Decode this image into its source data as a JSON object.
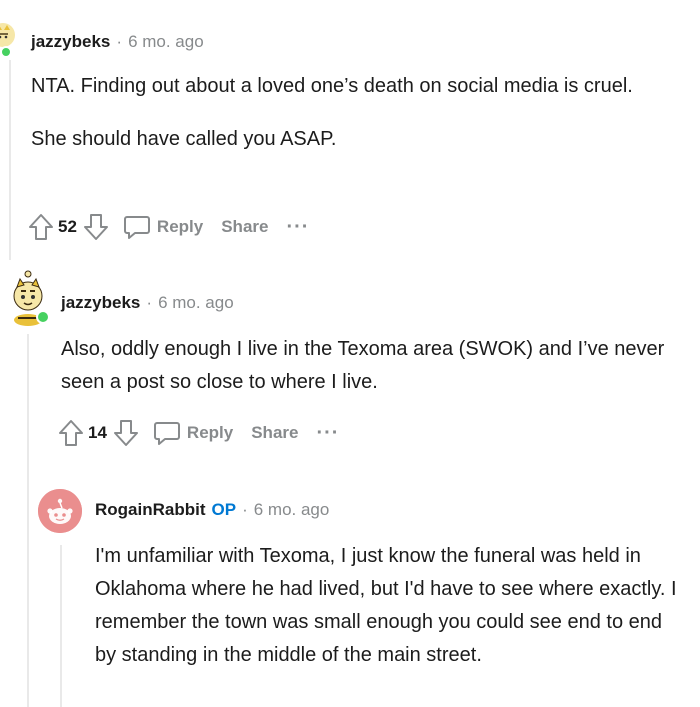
{
  "comments": [
    {
      "username": "jazzybeks",
      "op_label": "",
      "separator": "·",
      "time": "6 mo. ago",
      "body": [
        "NTA. Finding out about a loved one’s death on social media is cruel.",
        "She should have called you ASAP."
      ],
      "votes": "52",
      "reply_label": "Reply",
      "share_label": "Share",
      "more_label": "···"
    },
    {
      "username": "jazzybeks",
      "op_label": "",
      "separator": "·",
      "time": "6 mo. ago",
      "body": [
        "Also, oddly enough I live in the Texoma area (SWOK) and I’ve never seen a post so close to where I live."
      ],
      "votes": "14",
      "reply_label": "Reply",
      "share_label": "Share",
      "more_label": "···"
    },
    {
      "username": "RogainRabbit",
      "op_label": "OP",
      "separator": "·",
      "time": "6 mo. ago",
      "body": [
        "I'm unfamiliar with Texoma, I just know the funeral was held in Oklahoma where he had lived, but I'd have to see where exactly. I remember the town was small enough you could see end to end by standing in the middle of the main street."
      ]
    }
  ],
  "colors": {
    "online": "#46d160",
    "op": "#0079d3",
    "muted": "#878a8c",
    "snoo_bg": "#ea8e8e"
  },
  "icons": {
    "upvote": "upvote-arrow-icon",
    "downvote": "downvote-arrow-icon",
    "reply": "speech-bubble-icon",
    "avatar1": "tiger-avatar-icon",
    "avatar3": "snoo-avatar-icon"
  }
}
